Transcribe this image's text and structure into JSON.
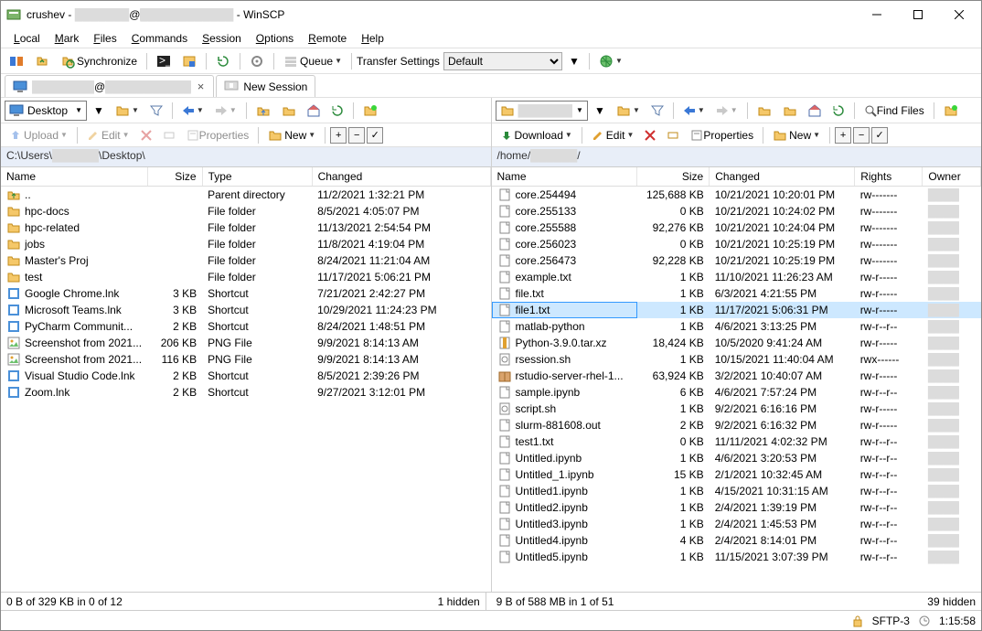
{
  "window": {
    "title_prefix": "crushev - ",
    "title_masked1": "███████",
    "title_at": "@",
    "title_masked2": "████████████",
    "title_suffix": " - WinSCP"
  },
  "menu": {
    "items": [
      "Local",
      "Mark",
      "Files",
      "Commands",
      "Session",
      "Options",
      "Remote",
      "Help"
    ]
  },
  "toolbar": {
    "sync_label": "Synchronize",
    "queue_label": "Queue",
    "transfer_label": "Transfer Settings",
    "transfer_value": "Default"
  },
  "tabs": {
    "session_masked1": "████████",
    "session_at": "@",
    "session_masked2": "███████████",
    "new_session": "New Session"
  },
  "left": {
    "drive_label": "Desktop",
    "upload_label": "Upload",
    "edit_label": "Edit",
    "properties_label": "Properties",
    "new_label": "New",
    "path_prefix": "C:\\Users\\",
    "path_masked": "██████",
    "path_suffix": "\\Desktop\\",
    "cols": {
      "name": "Name",
      "size": "Size",
      "type": "Type",
      "changed": "Changed"
    },
    "rows": [
      {
        "icon": "up",
        "name": "..",
        "size": "",
        "type": "Parent directory",
        "changed": "11/2/2021 1:32:21 PM"
      },
      {
        "icon": "folder",
        "name": "hpc-docs",
        "size": "",
        "type": "File folder",
        "changed": "8/5/2021 4:05:07 PM"
      },
      {
        "icon": "folder",
        "name": "hpc-related",
        "size": "",
        "type": "File folder",
        "changed": "11/13/2021 2:54:54 PM"
      },
      {
        "icon": "folder",
        "name": "jobs",
        "size": "",
        "type": "File folder",
        "changed": "11/8/2021 4:19:04 PM"
      },
      {
        "icon": "folder",
        "name": "Master's Proj",
        "size": "",
        "type": "File folder",
        "changed": "8/24/2021 11:21:04 AM"
      },
      {
        "icon": "folder",
        "name": "test",
        "size": "",
        "type": "File folder",
        "changed": "11/17/2021 5:06:21 PM"
      },
      {
        "icon": "app",
        "name": "Google Chrome.lnk",
        "size": "3 KB",
        "type": "Shortcut",
        "changed": "7/21/2021 2:42:27 PM"
      },
      {
        "icon": "app",
        "name": "Microsoft Teams.lnk",
        "size": "3 KB",
        "type": "Shortcut",
        "changed": "10/29/2021 11:24:23 PM"
      },
      {
        "icon": "app",
        "name": "PyCharm Communit...",
        "size": "2 KB",
        "type": "Shortcut",
        "changed": "8/24/2021 1:48:51 PM"
      },
      {
        "icon": "img",
        "name": "Screenshot from 2021...",
        "size": "206 KB",
        "type": "PNG File",
        "changed": "9/9/2021 8:14:13 AM"
      },
      {
        "icon": "img",
        "name": "Screenshot from 2021...",
        "size": "116 KB",
        "type": "PNG File",
        "changed": "9/9/2021 8:14:13 AM"
      },
      {
        "icon": "app",
        "name": "Visual Studio Code.lnk",
        "size": "2 KB",
        "type": "Shortcut",
        "changed": "8/5/2021 2:39:26 PM"
      },
      {
        "icon": "app",
        "name": "Zoom.lnk",
        "size": "2 KB",
        "type": "Shortcut",
        "changed": "9/27/2021 3:12:01 PM"
      }
    ],
    "status_left": "0 B of 329 KB in 0 of 12",
    "status_right": "1 hidden"
  },
  "right": {
    "drive_masked": "███████",
    "download_label": "Download",
    "edit_label": "Edit",
    "properties_label": "Properties",
    "new_label": "New",
    "findfiles_label": "Find Files",
    "path_prefix": "/home/",
    "path_masked": "██████",
    "path_suffix": "/",
    "cols": {
      "name": "Name",
      "size": "Size",
      "changed": "Changed",
      "rights": "Rights",
      "owner": "Owner"
    },
    "rows": [
      {
        "icon": "file",
        "name": "core.254494",
        "size": "125,688 KB",
        "changed": "10/21/2021 10:20:01 PM",
        "rights": "rw-------",
        "selected": false
      },
      {
        "icon": "file",
        "name": "core.255133",
        "size": "0 KB",
        "changed": "10/21/2021 10:24:02 PM",
        "rights": "rw-------",
        "selected": false
      },
      {
        "icon": "file",
        "name": "core.255588",
        "size": "92,276 KB",
        "changed": "10/21/2021 10:24:04 PM",
        "rights": "rw-------",
        "selected": false
      },
      {
        "icon": "file",
        "name": "core.256023",
        "size": "0 KB",
        "changed": "10/21/2021 10:25:19 PM",
        "rights": "rw-------",
        "selected": false
      },
      {
        "icon": "file",
        "name": "core.256473",
        "size": "92,228 KB",
        "changed": "10/21/2021 10:25:19 PM",
        "rights": "rw-------",
        "selected": false
      },
      {
        "icon": "file",
        "name": "example.txt",
        "size": "1 KB",
        "changed": "11/10/2021 11:26:23 AM",
        "rights": "rw-r-----",
        "selected": false
      },
      {
        "icon": "file",
        "name": "file.txt",
        "size": "1 KB",
        "changed": "6/3/2021 4:21:55 PM",
        "rights": "rw-r-----",
        "selected": false
      },
      {
        "icon": "file",
        "name": "file1.txt",
        "size": "1 KB",
        "changed": "11/17/2021 5:06:31 PM",
        "rights": "rw-r-----",
        "selected": true
      },
      {
        "icon": "file",
        "name": "matlab-python",
        "size": "1 KB",
        "changed": "4/6/2021 3:13:25 PM",
        "rights": "rw-r--r--",
        "selected": false
      },
      {
        "icon": "arch",
        "name": "Python-3.9.0.tar.xz",
        "size": "18,424 KB",
        "changed": "10/5/2020 9:41:24 AM",
        "rights": "rw-r-----",
        "selected": false
      },
      {
        "icon": "sh",
        "name": "rsession.sh",
        "size": "1 KB",
        "changed": "10/15/2021 11:40:04 AM",
        "rights": "rwx------",
        "selected": false
      },
      {
        "icon": "pkg",
        "name": "rstudio-server-rhel-1...",
        "size": "63,924 KB",
        "changed": "3/2/2021 10:40:07 AM",
        "rights": "rw-r-----",
        "selected": false
      },
      {
        "icon": "file",
        "name": "sample.ipynb",
        "size": "6 KB",
        "changed": "4/6/2021 7:57:24 PM",
        "rights": "rw-r--r--",
        "selected": false
      },
      {
        "icon": "sh",
        "name": "script.sh",
        "size": "1 KB",
        "changed": "9/2/2021 6:16:16 PM",
        "rights": "rw-r-----",
        "selected": false
      },
      {
        "icon": "file",
        "name": "slurm-881608.out",
        "size": "2 KB",
        "changed": "9/2/2021 6:16:32 PM",
        "rights": "rw-r-----",
        "selected": false
      },
      {
        "icon": "file",
        "name": "test1.txt",
        "size": "0 KB",
        "changed": "11/11/2021 4:02:32 PM",
        "rights": "rw-r--r--",
        "selected": false
      },
      {
        "icon": "file",
        "name": "Untitled.ipynb",
        "size": "1 KB",
        "changed": "4/6/2021 3:20:53 PM",
        "rights": "rw-r--r--",
        "selected": false
      },
      {
        "icon": "file",
        "name": "Untitled_1.ipynb",
        "size": "15 KB",
        "changed": "2/1/2021 10:32:45 AM",
        "rights": "rw-r--r--",
        "selected": false
      },
      {
        "icon": "file",
        "name": "Untitled1.ipynb",
        "size": "1 KB",
        "changed": "4/15/2021 10:31:15 AM",
        "rights": "rw-r--r--",
        "selected": false
      },
      {
        "icon": "file",
        "name": "Untitled2.ipynb",
        "size": "1 KB",
        "changed": "2/4/2021 1:39:19 PM",
        "rights": "rw-r--r--",
        "selected": false
      },
      {
        "icon": "file",
        "name": "Untitled3.ipynb",
        "size": "1 KB",
        "changed": "2/4/2021 1:45:53 PM",
        "rights": "rw-r--r--",
        "selected": false
      },
      {
        "icon": "file",
        "name": "Untitled4.ipynb",
        "size": "4 KB",
        "changed": "2/4/2021 8:14:01 PM",
        "rights": "rw-r--r--",
        "selected": false
      },
      {
        "icon": "file",
        "name": "Untitled5.ipynb",
        "size": "1 KB",
        "changed": "11/15/2021 3:07:39 PM",
        "rights": "rw-r--r--",
        "selected": false
      }
    ],
    "status_left": "9 B of 588 MB in 1 of 51",
    "status_right": "39 hidden"
  },
  "footer": {
    "protocol": "SFTP-3",
    "time": "1:15:58"
  }
}
